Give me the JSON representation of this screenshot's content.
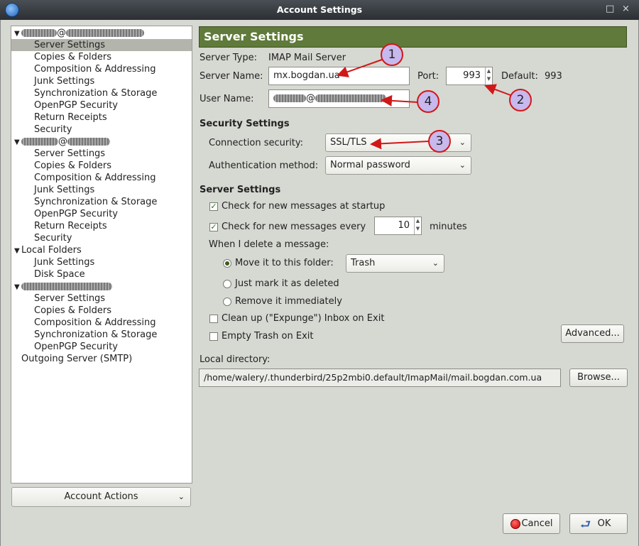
{
  "window": {
    "title": "Account Settings",
    "controls": [
      "□",
      "×"
    ]
  },
  "tree": {
    "accounts": [
      {
        "at": "@",
        "items": [
          "Server Settings",
          "Copies & Folders",
          "Composition & Addressing",
          "Junk Settings",
          "Synchronization & Storage",
          "OpenPGP Security",
          "Return Receipts",
          "Security"
        ]
      },
      {
        "at": "@",
        "items": [
          "Server Settings",
          "Copies & Folders",
          "Composition & Addressing",
          "Junk Settings",
          "Synchronization & Storage",
          "OpenPGP Security",
          "Return Receipts",
          "Security"
        ]
      },
      {
        "label": "Local Folders",
        "items": [
          "Junk Settings",
          "Disk Space"
        ]
      },
      {
        "items": [
          "Server Settings",
          "Copies & Folders",
          "Composition & Addressing",
          "Synchronization & Storage",
          "OpenPGP Security"
        ]
      }
    ],
    "outgoing": "Outgoing Server (SMTP)",
    "selected_item": "Server Settings"
  },
  "account_actions": "Account Actions",
  "panel": {
    "header": "Server Settings",
    "server_type_label": "Server Type:",
    "server_type": "IMAP Mail Server",
    "server_name_label": "Server Name:",
    "server_name": "mx.bogdan.ua",
    "port_label": "Port:",
    "port": "993",
    "default_label": "Default:",
    "default_port": "993",
    "user_name_label": "User Name:",
    "user_name_at": "@",
    "security_heading": "Security Settings",
    "conn_security_label": "Connection security:",
    "conn_security": "SSL/TLS",
    "auth_label": "Authentication method:",
    "auth": "Normal password",
    "server_settings_heading": "Server Settings",
    "check_startup": "Check for new messages at startup",
    "check_every": "Check for new messages every",
    "minutes_value": "10",
    "minutes_label": "minutes",
    "delete_label": "When I delete a message:",
    "move_to": "Move it to this folder:",
    "folder": "Trash",
    "just_mark": "Just mark it as deleted",
    "remove": "Remove it immediately",
    "cleanup": "Clean up (\"Expunge\") Inbox on Exit",
    "empty_trash": "Empty Trash on Exit",
    "advanced": "Advanced...",
    "local_dir_label": "Local directory:",
    "local_dir": "/home/walery/.thunderbird/25p2mbi0.default/ImapMail/mail.bogdan.com.ua",
    "browse": "Browse..."
  },
  "buttons": {
    "cancel": "Cancel",
    "ok": "OK"
  },
  "callouts": [
    "1",
    "2",
    "3",
    "4"
  ],
  "colors": {
    "header_bg": "#5f7a3a",
    "callout_fill": "#c7b8ee",
    "callout_border": "#d01818",
    "selection": "#b3b5ad"
  }
}
